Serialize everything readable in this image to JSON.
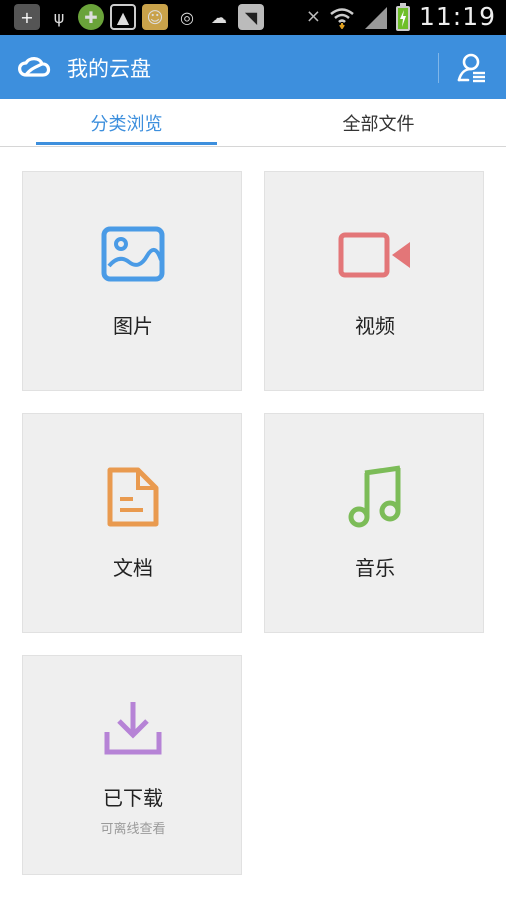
{
  "status_bar": {
    "time": "11:19",
    "icons": [
      "add-icon",
      "usb-icon",
      "app-icon",
      "image-icon",
      "app-icon",
      "wechat-icon",
      "weather-icon",
      "app-icon",
      "mute-icon",
      "wifi-icon",
      "signal-icon",
      "battery-icon"
    ]
  },
  "app_bar": {
    "title": "我的云盘",
    "colors": {
      "primary": "#3d8fdd"
    }
  },
  "tabs": [
    {
      "label": "分类浏览",
      "active": true
    },
    {
      "label": "全部文件",
      "active": false
    }
  ],
  "categories": [
    {
      "label": "图片",
      "icon": "image-icon",
      "color": "#4a9be6"
    },
    {
      "label": "视频",
      "icon": "video-icon",
      "color": "#e37678"
    },
    {
      "label": "文档",
      "icon": "document-icon",
      "color": "#e99a4f"
    },
    {
      "label": "音乐",
      "icon": "music-icon",
      "color": "#7cbc58"
    },
    {
      "label": "已下载",
      "sub": "可离线查看",
      "icon": "download-icon",
      "color": "#b683d6"
    }
  ]
}
